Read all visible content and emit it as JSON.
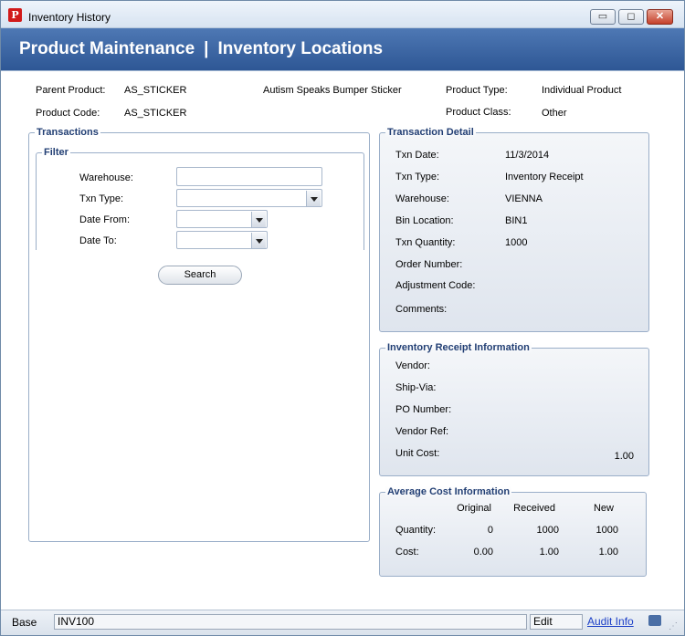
{
  "window": {
    "title": "Inventory History",
    "min": "▭",
    "max": "◻",
    "close": "✕"
  },
  "banner": {
    "left": "Product Maintenance",
    "sep": "|",
    "right": "Inventory Locations"
  },
  "product": {
    "parent_label": "Parent Product:",
    "parent_value": "AS_STICKER",
    "description": "Autism Speaks Bumper Sticker",
    "type_label": "Product Type:",
    "type_value": "Individual Product",
    "code_label": "Product Code:",
    "code_value": "AS_STICKER",
    "class_label": "Product Class:",
    "class_value": "Other"
  },
  "transactions": {
    "title": "Transactions",
    "filter_title": "Filter",
    "warehouse_label": "Warehouse:",
    "warehouse_value": "",
    "txn_type_label": "Txn Type:",
    "txn_type_value": "",
    "date_from_label": "Date From:",
    "date_from_value": "",
    "date_to_label": "Date To:",
    "date_to_value": "",
    "search_label": "Search"
  },
  "detail": {
    "title": "Transaction Detail",
    "rows": [
      {
        "label": "Txn Date:",
        "value": "11/3/2014"
      },
      {
        "label": "Txn Type:",
        "value": "Inventory Receipt"
      },
      {
        "label": "Warehouse:",
        "value": "VIENNA"
      },
      {
        "label": "Bin Location:",
        "value": "BIN1"
      },
      {
        "label": "Txn Quantity:",
        "value": "1000"
      },
      {
        "label": "Order Number:",
        "value": ""
      },
      {
        "label": "Adjustment Code:",
        "value": ""
      },
      {
        "label": "Comments:",
        "value": ""
      }
    ]
  },
  "receipt": {
    "title": "Inventory Receipt Information",
    "vendor": "Vendor:",
    "ship_via": "Ship-Via:",
    "po_number": "PO Number:",
    "vendor_ref": "Vendor Ref:",
    "unit_cost_label": "Unit Cost:",
    "unit_cost_value": "1.00"
  },
  "avg_cost": {
    "title": "Average Cost Information",
    "col_original": "Original",
    "col_received": "Received",
    "col_new": "New",
    "qty_label": "Quantity:",
    "qty_original": "0",
    "qty_received": "1000",
    "qty_new": "1000",
    "cost_label": "Cost:",
    "cost_original": "0.00",
    "cost_received": "1.00",
    "cost_new": "1.00"
  },
  "status": {
    "base": "Base",
    "code": "INV100",
    "mode": "Edit",
    "audit": "Audit Info"
  }
}
